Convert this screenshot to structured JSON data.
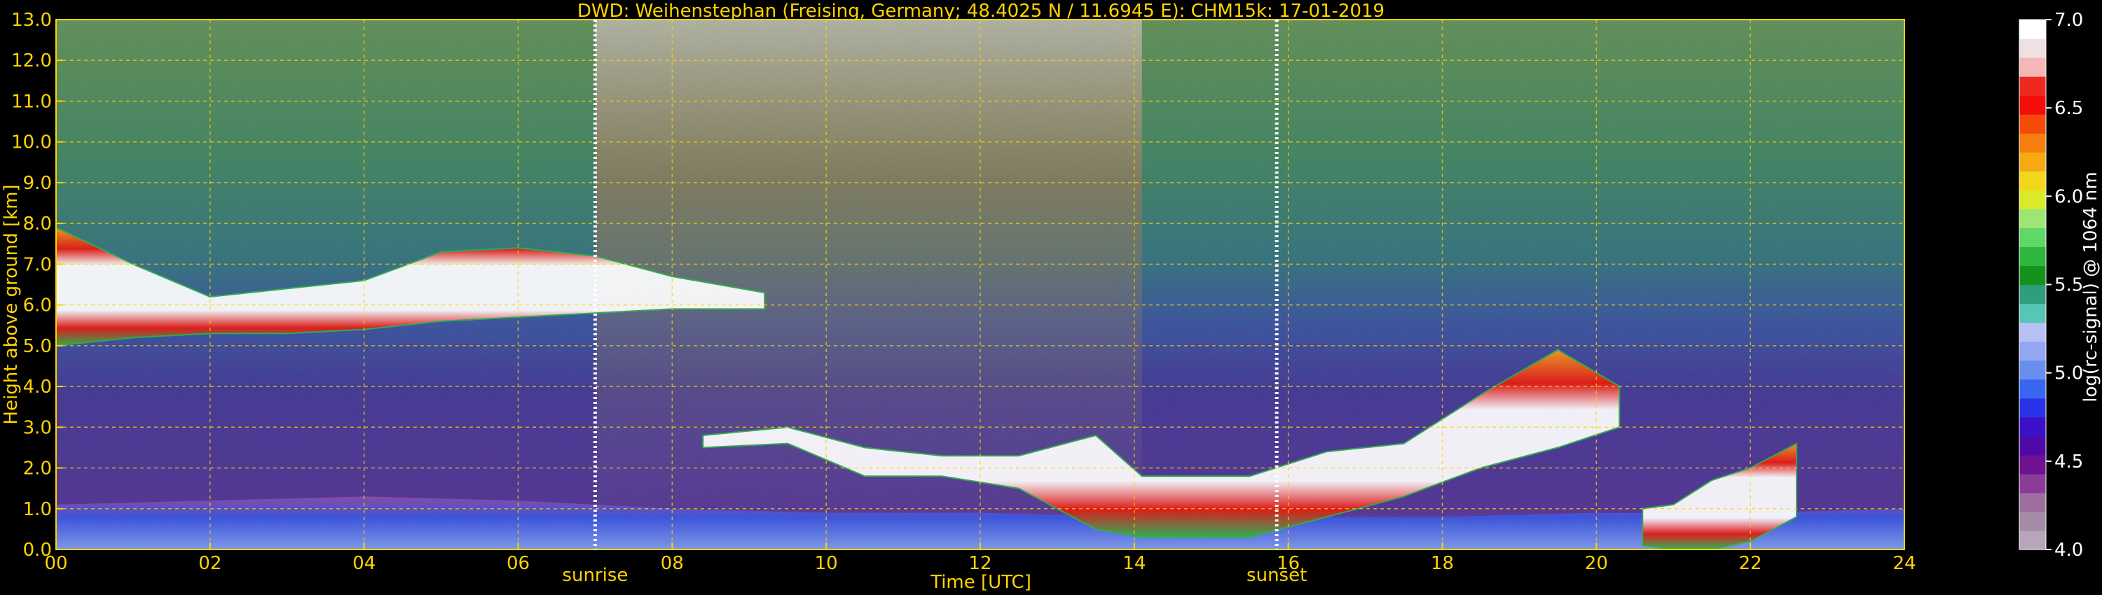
{
  "chart_data": {
    "type": "heatmap",
    "title": "DWD: Weihenstephan (Freising, Germany; 48.4025 N / 11.6945 E):    CHM15k: 17-01-2019",
    "xlabel": "Time [UTC]",
    "ylabel": "Height above ground [km]",
    "xlim": [
      0,
      24
    ],
    "ylim": [
      0,
      13
    ],
    "x_ticks": [
      "00",
      "02",
      "04",
      "06",
      "08",
      "10",
      "12",
      "14",
      "16",
      "18",
      "20",
      "22",
      "24"
    ],
    "y_ticks": [
      "0.0",
      "1.0",
      "2.0",
      "3.0",
      "4.0",
      "5.0",
      "6.0",
      "7.0",
      "8.0",
      "9.0",
      "10.0",
      "11.0",
      "12.0",
      "13.0"
    ],
    "grid": true,
    "markers": [
      {
        "label": "sunrise",
        "time": 7.0
      },
      {
        "label": "sunset",
        "time": 15.85
      }
    ],
    "colorbar": {
      "label": "log(rc-signal) @ 1064 nm",
      "range": [
        4.0,
        7.0
      ],
      "ticks": [
        "4.0",
        "4.5",
        "5.0",
        "5.5",
        "6.0",
        "6.5",
        "7.0"
      ],
      "colors": [
        "#b7a6b9",
        "#a68ba6",
        "#9d6e9e",
        "#8a3d96",
        "#6e1292",
        "#4e0aa8",
        "#3b10c8",
        "#2a33e8",
        "#3866f0",
        "#6a8ef0",
        "#93a6f2",
        "#b7c1f5",
        "#58c6b6",
        "#2e9e7c",
        "#16921c",
        "#2bb83c",
        "#5fd868",
        "#9ee674",
        "#d8ea2a",
        "#f2d61a",
        "#f5aa14",
        "#f57e0e",
        "#f44a0a",
        "#f40e0a",
        "#ee2a20",
        "#f5b6b6",
        "#efe0e2",
        "#ffffff"
      ]
    },
    "layers": [
      {
        "name": "aerosol layer",
        "t": [
          0,
          2,
          4,
          6,
          8,
          10,
          12,
          14,
          16,
          18,
          20,
          22,
          24
        ],
        "top_km": [
          1.1,
          1.2,
          1.3,
          1.2,
          1.0,
          0.9,
          0.9,
          0.8,
          0.8,
          0.8,
          0.9,
          0.9,
          1.0
        ],
        "level": 4.9
      },
      {
        "name": "cloud layer",
        "t": [
          0,
          1,
          2,
          3,
          4,
          5,
          6,
          7,
          8,
          9.2
        ],
        "base_km": [
          5.0,
          5.2,
          5.3,
          5.3,
          5.4,
          5.6,
          5.7,
          5.8,
          5.9,
          5.9
        ],
        "top_km": [
          7.9,
          7.0,
          6.2,
          6.4,
          6.6,
          7.3,
          7.4,
          7.2,
          6.7,
          6.3
        ],
        "level": 7.0
      },
      {
        "name": "cloud layer",
        "t": [
          8.4,
          9.5,
          10.5,
          11.5,
          12.5,
          13.5,
          14.1,
          15.5,
          16.5,
          17.5,
          18.5,
          19.5,
          20.3
        ],
        "base_km": [
          2.5,
          2.6,
          1.8,
          1.8,
          1.5,
          0.5,
          0.3,
          0.3,
          0.8,
          1.3,
          2.0,
          2.5,
          3.0
        ],
        "top_km": [
          2.8,
          3.0,
          2.5,
          2.3,
          2.3,
          2.8,
          1.8,
          1.8,
          2.4,
          2.6,
          3.8,
          4.9,
          4.0
        ],
        "level": 7.0
      },
      {
        "name": "cloud layer",
        "t": [
          20.6,
          21.0,
          21.5,
          22.0,
          22.6
        ],
        "base_km": [
          0.1,
          0.0,
          0.0,
          0.2,
          0.8
        ],
        "top_km": [
          1.0,
          1.1,
          1.7,
          2.0,
          2.6
        ],
        "level": 6.5
      }
    ]
  }
}
